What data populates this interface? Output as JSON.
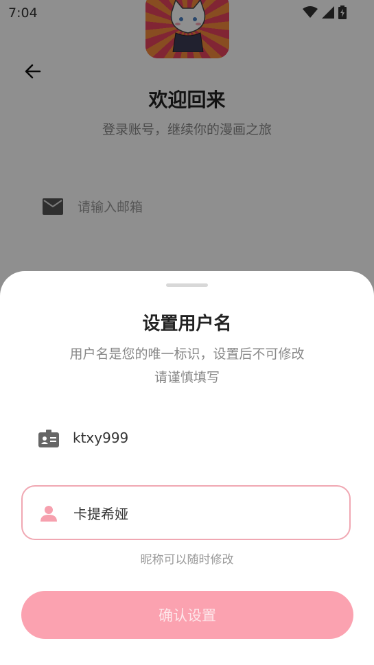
{
  "status_bar": {
    "time": "7:04"
  },
  "login": {
    "title": "欢迎回来",
    "subtitle": "登录账号，继续你的漫画之旅",
    "email_placeholder": "请输入邮箱"
  },
  "sheet": {
    "title": "设置用户名",
    "description_line1": "用户名是您的唯一标识，设置后不可修改",
    "description_line2": "请谨慎填写",
    "username_value": "ktxy999",
    "nickname_value": "卡提希娅",
    "nickname_hint": "昵称可以随时修改",
    "confirm_label": "确认设置"
  },
  "colors": {
    "accent": "#fba2b0",
    "accent_border": "#f0a7b2",
    "overlay": "#000000"
  },
  "icons": {
    "back": "arrow-left-icon",
    "email": "mail-icon",
    "username": "id-badge-icon",
    "nickname": "person-icon"
  }
}
